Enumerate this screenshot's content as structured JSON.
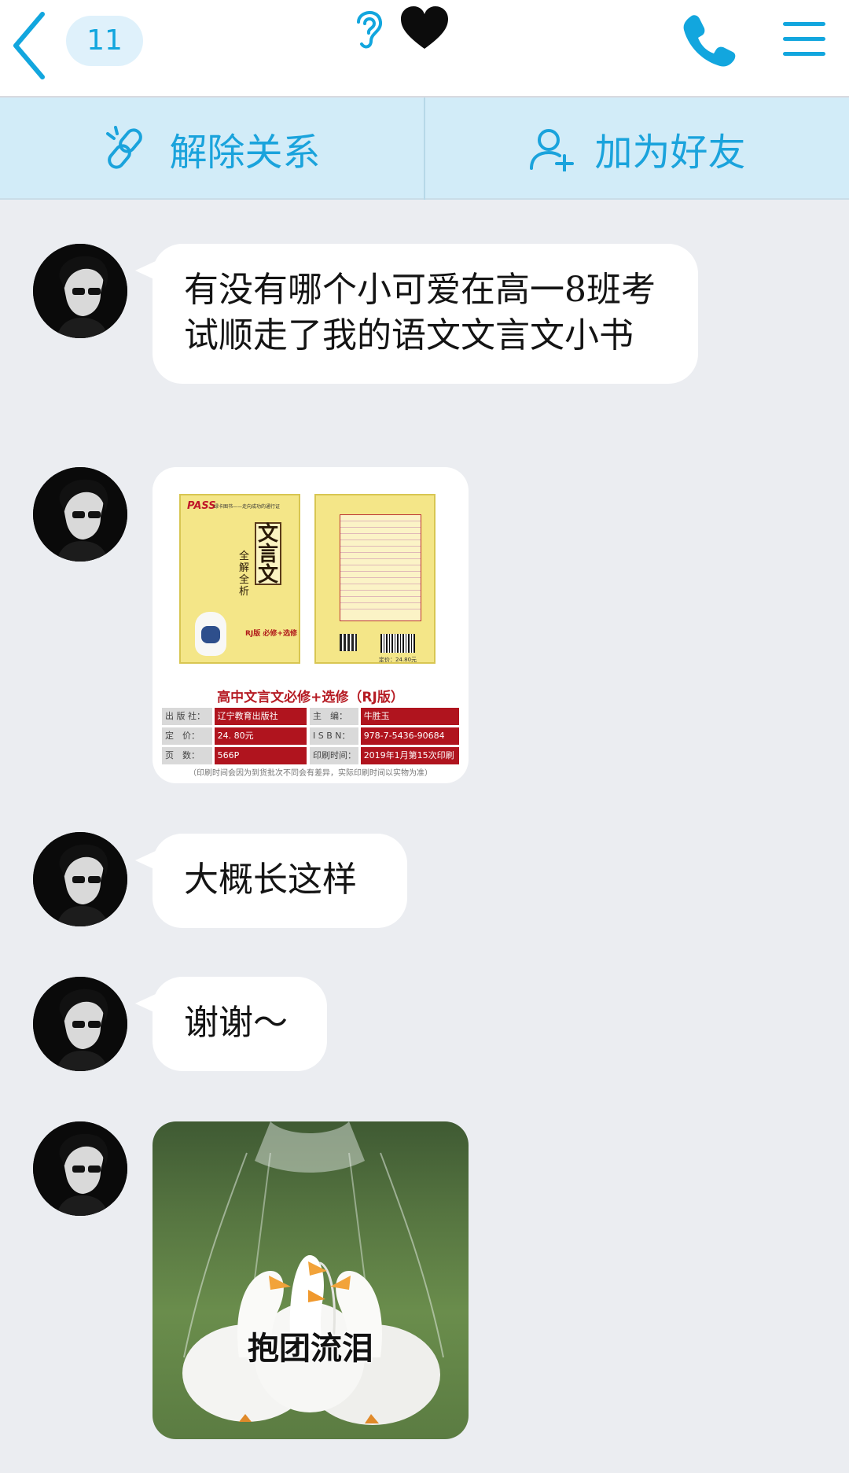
{
  "header": {
    "unread_count": "11",
    "icons": [
      "back-chevron-icon",
      "ear-icon",
      "black-heart-icon",
      "phone-icon",
      "menu-icon"
    ]
  },
  "actions": {
    "unbind_label": "解除关系",
    "add_friend_label": "加为好友"
  },
  "messages": [
    {
      "type": "text",
      "text": "有没有哪个小可爱在高一8班考试顺走了我的语文文言文小书"
    },
    {
      "type": "image",
      "description_key": "book"
    },
    {
      "type": "text",
      "text": "大概长这样"
    },
    {
      "type": "text",
      "text": "谢谢～"
    },
    {
      "type": "image",
      "description_key": "ducks"
    }
  ],
  "book_image": {
    "brand": "PASS",
    "tagline": "绿卡图书——走向成功的通行证",
    "cover_title": "文言文",
    "cover_subtitle": "全解全析",
    "cover_grade": "高中",
    "cover_edition": "RJ版 必修+选修",
    "caption": "高中文言文必修+选修（RJ版）",
    "rows": [
      {
        "k1": "出 版 社：",
        "v1": "辽宁教育出版社",
        "k2": "主　编：",
        "v2": "牛胜玉"
      },
      {
        "k1": "定　价：",
        "v1": "24. 80元",
        "k2": "I S B N：",
        "v2": "978-7-5436-90684"
      },
      {
        "k1": "页　数：",
        "v1": "566P",
        "k2": "印刷时间：",
        "v2": "2019年1月第15次印刷"
      }
    ],
    "note": "（印刷时间会因为到货批次不同会有差异，实际印刷时间以实物为准）",
    "price": "定价：24.80元"
  },
  "duck_image": {
    "caption": "抱团流泪"
  },
  "colors": {
    "accent": "#12a6de",
    "action_bar_bg": "#d2ecf8",
    "chat_bg": "#ebedf1",
    "bubble_bg": "#ffffff"
  }
}
